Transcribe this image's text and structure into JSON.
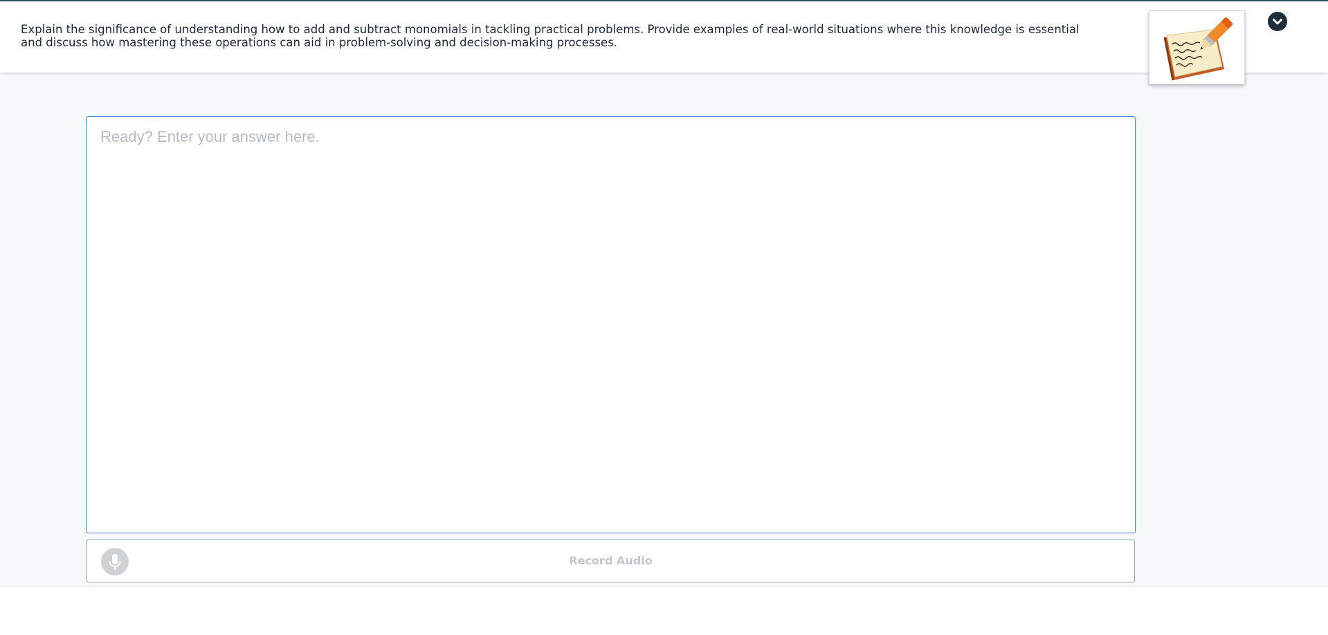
{
  "prompt": {
    "text": "Explain the significance of understanding how to add and subtract monomials in tackling practical problems. Provide examples of real-world situations where this knowledge is essential and discuss how mastering these operations can aid in problem-solving and decision-making processes.",
    "image_icon": "notebook-pen-icon"
  },
  "header": {
    "collapse_icon": "chevron-down-icon"
  },
  "answer": {
    "value": "",
    "placeholder": "Ready? Enter your answer here."
  },
  "record": {
    "label": "Record Audio",
    "icon": "microphone-icon"
  },
  "colors": {
    "input_border": "#4a86d4",
    "header_rule": "#2f4f5a",
    "collapse_button": "#1f2d3a",
    "mic_disabled": "#cfd2d5",
    "record_text": "#c3c7cb",
    "page_background": "#f7f8fa"
  }
}
